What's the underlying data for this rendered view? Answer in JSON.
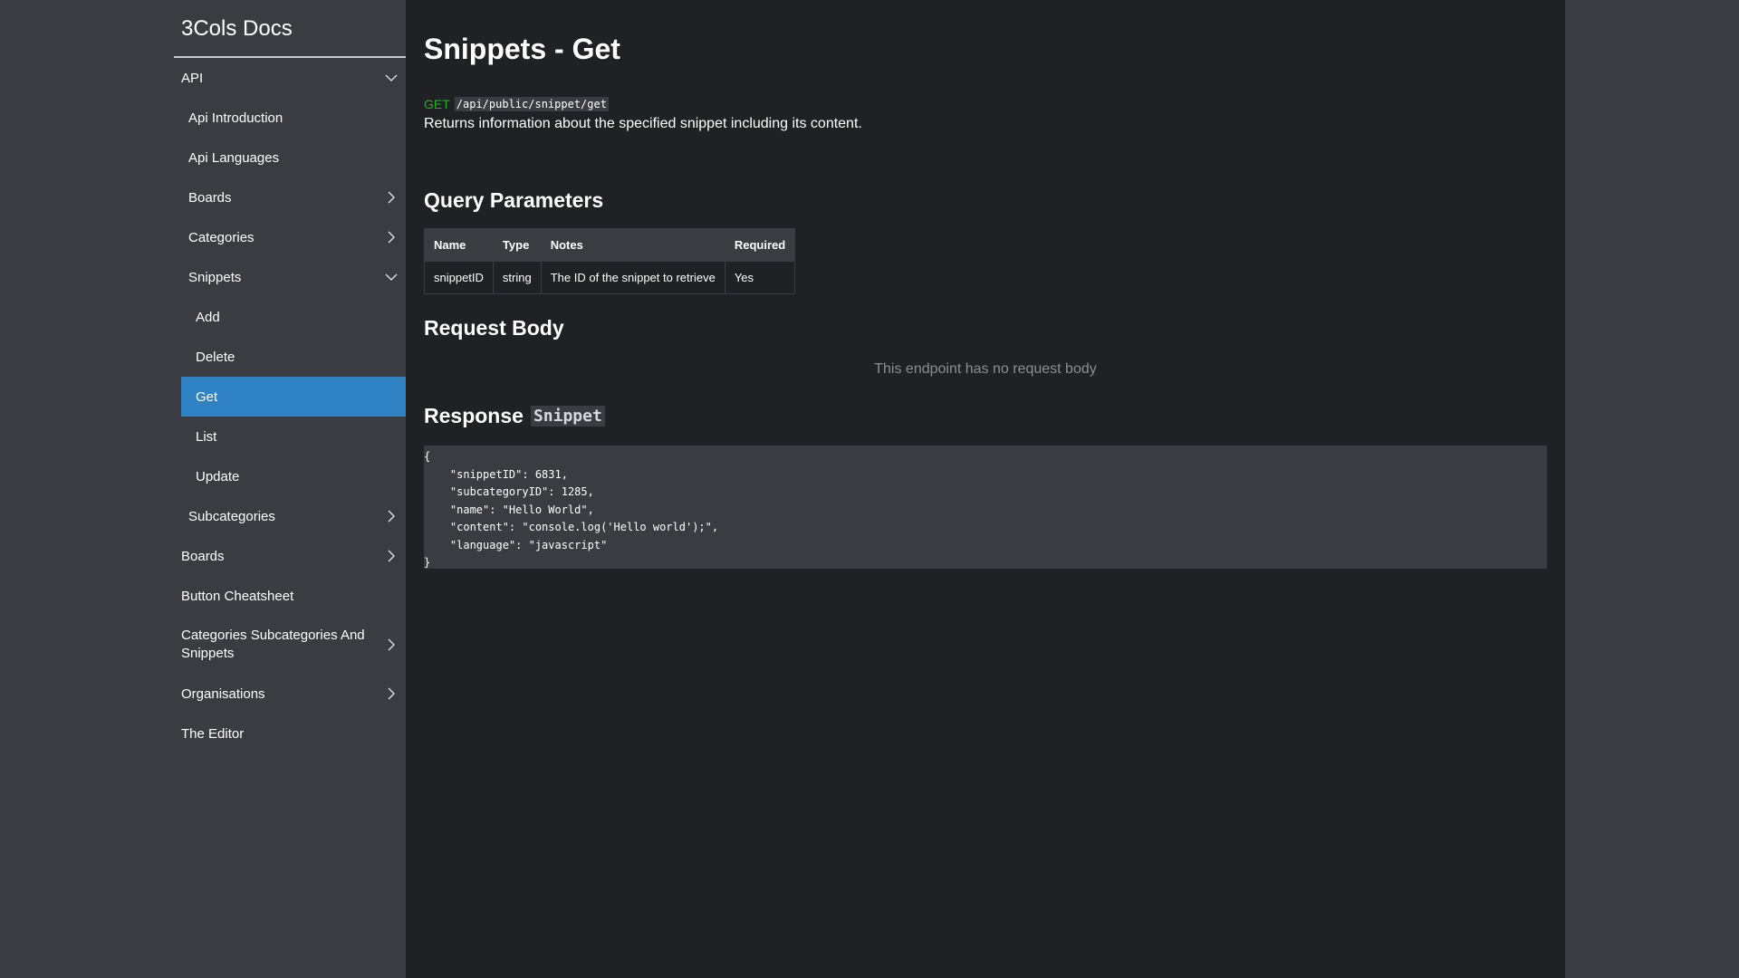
{
  "app": {
    "title": "3Cols Docs"
  },
  "sidebar": {
    "items": [
      {
        "label": "API",
        "chevron": "down"
      },
      {
        "label": "Api Introduction"
      },
      {
        "label": "Api Languages"
      },
      {
        "label": "Boards",
        "chevron": "right"
      },
      {
        "label": "Categories",
        "chevron": "right"
      },
      {
        "label": "Snippets",
        "chevron": "down"
      },
      {
        "label": "Add"
      },
      {
        "label": "Delete"
      },
      {
        "label": "Get",
        "active": true
      },
      {
        "label": "List"
      },
      {
        "label": "Update"
      },
      {
        "label": "Subcategories",
        "chevron": "right"
      },
      {
        "label": "Boards",
        "chevron": "right"
      },
      {
        "label": "Button Cheatsheet"
      },
      {
        "label": "Categories Subcategories And Snippets",
        "chevron": "right"
      },
      {
        "label": "Organisations",
        "chevron": "right"
      },
      {
        "label": "The Editor"
      }
    ]
  },
  "page": {
    "title": "Snippets - Get",
    "method": "GET",
    "path": "/api/public/snippet/get",
    "description": "Returns information about the specified snippet including its content."
  },
  "query_parameters": {
    "heading": "Query Parameters",
    "columns": [
      "Name",
      "Type",
      "Notes",
      "Required"
    ],
    "rows": [
      [
        "snippetID",
        "string",
        "The ID of the snippet to retrieve",
        "Yes"
      ]
    ]
  },
  "request_body": {
    "heading": "Request Body",
    "empty_text": "This endpoint has no request body"
  },
  "response": {
    "heading": "Response",
    "model": "Snippet",
    "code_lines": [
      "{",
      "    \"snippetID\": 6831,",
      "    \"subcategoryID\": 1285,",
      "    \"name\": \"Hello World\",",
      "    \"content\": \"console.log('Hello world');\",",
      "    \"language\": \"javascript\"",
      "}"
    ]
  },
  "colors": {
    "sidebar_bg": "#3b3b42",
    "main_bg": "#202124",
    "active_item": "#2f82c4",
    "method_green": "#1db51d"
  }
}
